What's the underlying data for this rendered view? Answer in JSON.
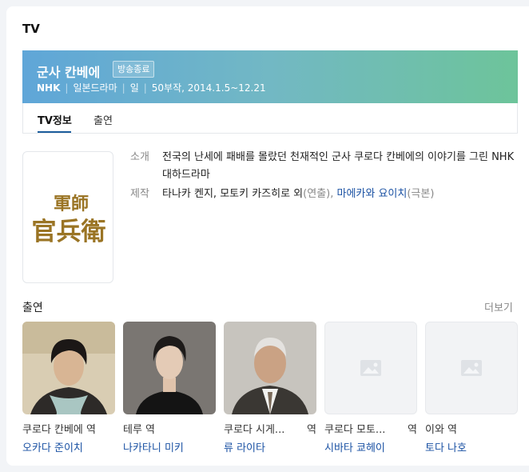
{
  "section": {
    "title": "TV"
  },
  "banner": {
    "title": "군사 칸베에",
    "badge": "방송종료",
    "meta": [
      "NHK",
      "일본드라마",
      "일",
      "50부작, 2014.1.5~12.21"
    ]
  },
  "tabs": [
    {
      "label": "TV정보",
      "active": true
    },
    {
      "label": "출연",
      "active": false
    }
  ],
  "poster": {
    "logo_text_top": "軍師",
    "logo_text_bottom": "官兵衛"
  },
  "info": {
    "intro_label": "소개",
    "intro_text": "전국의 난세에 패배를 몰랐던 천재적인 군사 쿠로다 칸베에의 이야기를 그린 NHK 대하드라마",
    "production_label": "제작",
    "production_people": "타나카 켄지, 모토키 카즈히로 외",
    "production_role1": "(연출),",
    "production_writer": "마에카와 요이치",
    "production_role2": "(극본)"
  },
  "cast": {
    "title": "출연",
    "more": "더보기",
    "items": [
      {
        "role": "쿠로다 칸베에 역",
        "role_suffix": "",
        "actor": "오카다 준이치",
        "photo": "portrait-young-man"
      },
      {
        "role": "테루 역",
        "role_suffix": "",
        "actor": "나카타니 미키",
        "photo": "portrait-woman"
      },
      {
        "role": "쿠로다 시게...",
        "role_suffix": "역",
        "actor": "류 라이타",
        "photo": "portrait-older-man"
      },
      {
        "role": "쿠로다 모토...",
        "role_suffix": "역",
        "actor": "시바타 쿄헤이",
        "photo": "image-placeholder-icon"
      },
      {
        "role": "이와 역",
        "role_suffix": "",
        "actor": "토다 나호",
        "photo": "image-placeholder-icon"
      }
    ]
  },
  "colors": {
    "banner_gradient": [
      "#5fa6d8",
      "#72b8c4",
      "#6dc49a"
    ],
    "link": "#1a51a3",
    "poster_gold": "#9a7424"
  }
}
